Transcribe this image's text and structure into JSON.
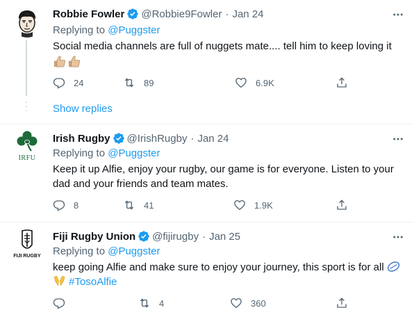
{
  "tweets": [
    {
      "name": "Robbie Fowler",
      "handle": "@Robbie9Fowler",
      "sep": "·",
      "date": "Jan 24",
      "replying_prefix": "Replying to ",
      "replying_handle": "@Puggster",
      "text": "Social media channels are full of nuggets mate.... tell him to keep loving it",
      "replies": "24",
      "retweets": "89",
      "likes": "6.9K",
      "avatar_icon": "cartoon-face-avatar",
      "emoji_icons": [
        "thumbs-up-emoji",
        "thumbs-up-emoji"
      ]
    },
    {
      "name": "Irish Rugby",
      "handle": "@IrishRugby",
      "sep": "·",
      "date": "Jan 24",
      "replying_prefix": "Replying to ",
      "replying_handle": "@Puggster",
      "text": "Keep it up Alfie, enjoy your rugby, our game is for everyone. Listen to your dad and your friends and team mates.",
      "replies": "8",
      "retweets": "41",
      "likes": "1.9K",
      "avatar_text": "IRFU",
      "avatar_icon": "shamrock-logo"
    },
    {
      "name": "Fiji Rugby Union",
      "handle": "@fijirugby",
      "sep": "·",
      "date": "Jan 25",
      "replying_prefix": "Replying to ",
      "replying_handle": "@Puggster",
      "text": "keep going Alfie and make sure to enjoy your journey, this sport is for all",
      "hashtag": "#TosoAlfie",
      "replies": "",
      "retweets": "4",
      "likes": "360",
      "avatar_text": "FIJI RUGBY",
      "avatar_icon": "fiji-rugby-logo",
      "emoji_icons": [
        "rugby-ball-emoji",
        "raising-hands-emoji"
      ]
    }
  ],
  "show_replies": "Show replies",
  "colors": {
    "accent": "#1d9bf0",
    "secondary_text": "#536471",
    "primary_text": "#0f1419",
    "divider": "#eff3f4",
    "verified": "#1d9bf0"
  }
}
